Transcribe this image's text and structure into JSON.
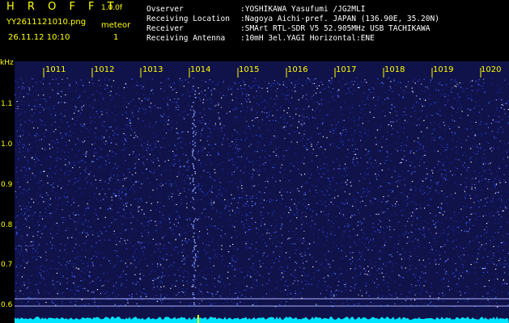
{
  "app": {
    "title": "H R O F F T",
    "version": "1.0.0f"
  },
  "file": {
    "name": "YY2611121010.png",
    "datetime": "26.11.12 10:10"
  },
  "meteor": {
    "label": "meteor",
    "count": "1"
  },
  "info": [
    {
      "label": "Ovserver",
      "value": ":YOSHIKAWA Yasufumi /JG2MLI"
    },
    {
      "label": "Receiving Location",
      "value": ":Nagoya Aichi-pref. JAPAN (136.90E, 35.20N)"
    },
    {
      "label": "Receiver",
      "value": ":SMArt RTL-SDR V5 52.905MHz USB TACHIKAWA"
    },
    {
      "label": "Receiving Antenna",
      "value": ":10mH 3el.YAGI Horizontal:ENE"
    }
  ],
  "axis": {
    "y_unit": "kHz",
    "y_ticks": [
      "1.1",
      "1.0",
      "0.9",
      "0.8",
      "0.7",
      "0.6"
    ],
    "x_ticks": [
      "1011",
      "1012",
      "1013",
      "1014",
      "1015",
      "1016",
      "1017",
      "1018",
      "1019",
      "1020"
    ]
  },
  "colors": {
    "label": "#ffff00",
    "text": "#ffffff",
    "background": "#000000",
    "spectrum": "#00e5ff"
  }
}
